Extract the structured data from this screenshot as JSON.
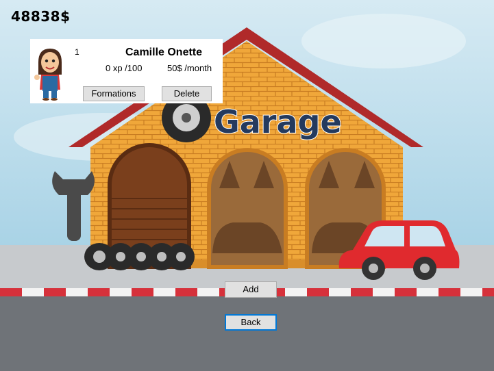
{
  "money": "48838$",
  "garage_sign": "Garage",
  "employee": {
    "level": "1",
    "name": "Camille Onette",
    "xp": "0 xp /100",
    "salary": "50$ /month",
    "formations_label": "Formations",
    "delete_label": "Delete"
  },
  "buttons": {
    "add_label": "Add",
    "back_label": "Back"
  }
}
